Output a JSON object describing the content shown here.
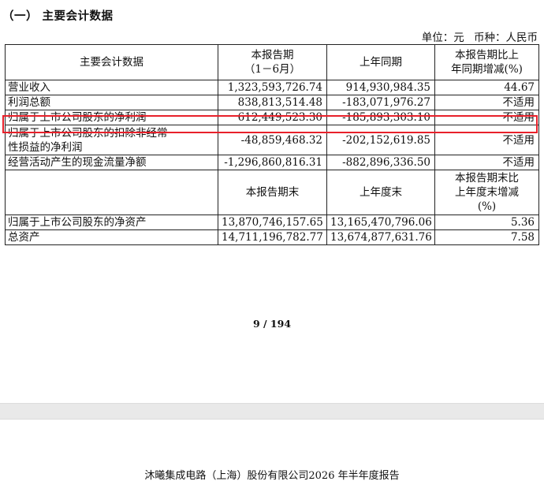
{
  "section_title": "（一） 主要会计数据",
  "unit_line": {
    "unit": "单位：元",
    "currency": "币种：人民币"
  },
  "table": {
    "header1": {
      "col1": "主要会计数据",
      "col2_line1": "本报告期",
      "col2_line2": "（1－6月）",
      "col3": "上年同期",
      "col4_line1": "本报告期比上",
      "col4_line2": "年同期增减(%)"
    },
    "rows1": [
      {
        "label": "营业收入",
        "current": "1,323,593,726.74",
        "prior": "914,930,984.35",
        "change": "44.67"
      },
      {
        "label": "利润总额",
        "current": "838,813,514.48",
        "prior": "-183,071,976.27",
        "change": "不适用"
      },
      {
        "label": "归属于上市公司股东的净利润",
        "current": "612,449,523.30",
        "prior": "-185,893,303.10",
        "change": "不适用"
      },
      {
        "label_line1": "归属于上市公司股东的扣除非经常",
        "label_line2": "性损益的净利润",
        "current": "-48,859,468.32",
        "prior": "-202,152,619.85",
        "change": "不适用"
      },
      {
        "label": "经营活动产生的现金流量净额",
        "current": "-1,296,860,816.31",
        "prior": "-882,896,336.50",
        "change": "不适用"
      }
    ],
    "header2": {
      "col2": "本报告期末",
      "col3": "上年度末",
      "col4_line1": "本报告期末比",
      "col4_line2": "上年度末增减",
      "col4_line3": "(%)"
    },
    "rows2": [
      {
        "label": "归属于上市公司股东的净资产",
        "current": "13,870,746,157.65",
        "prior": "13,165,470,796.06",
        "change": "5.36"
      },
      {
        "label": "总资产",
        "current": "14,711,196,782.77",
        "prior": "13,674,877,631.76",
        "change": "7.58"
      }
    ]
  },
  "page_number": "9 / 194",
  "footer_title": "沐曦集成电路（上海）股份有限公司2026 年半年度报告",
  "highlight_color": "#e8202a"
}
